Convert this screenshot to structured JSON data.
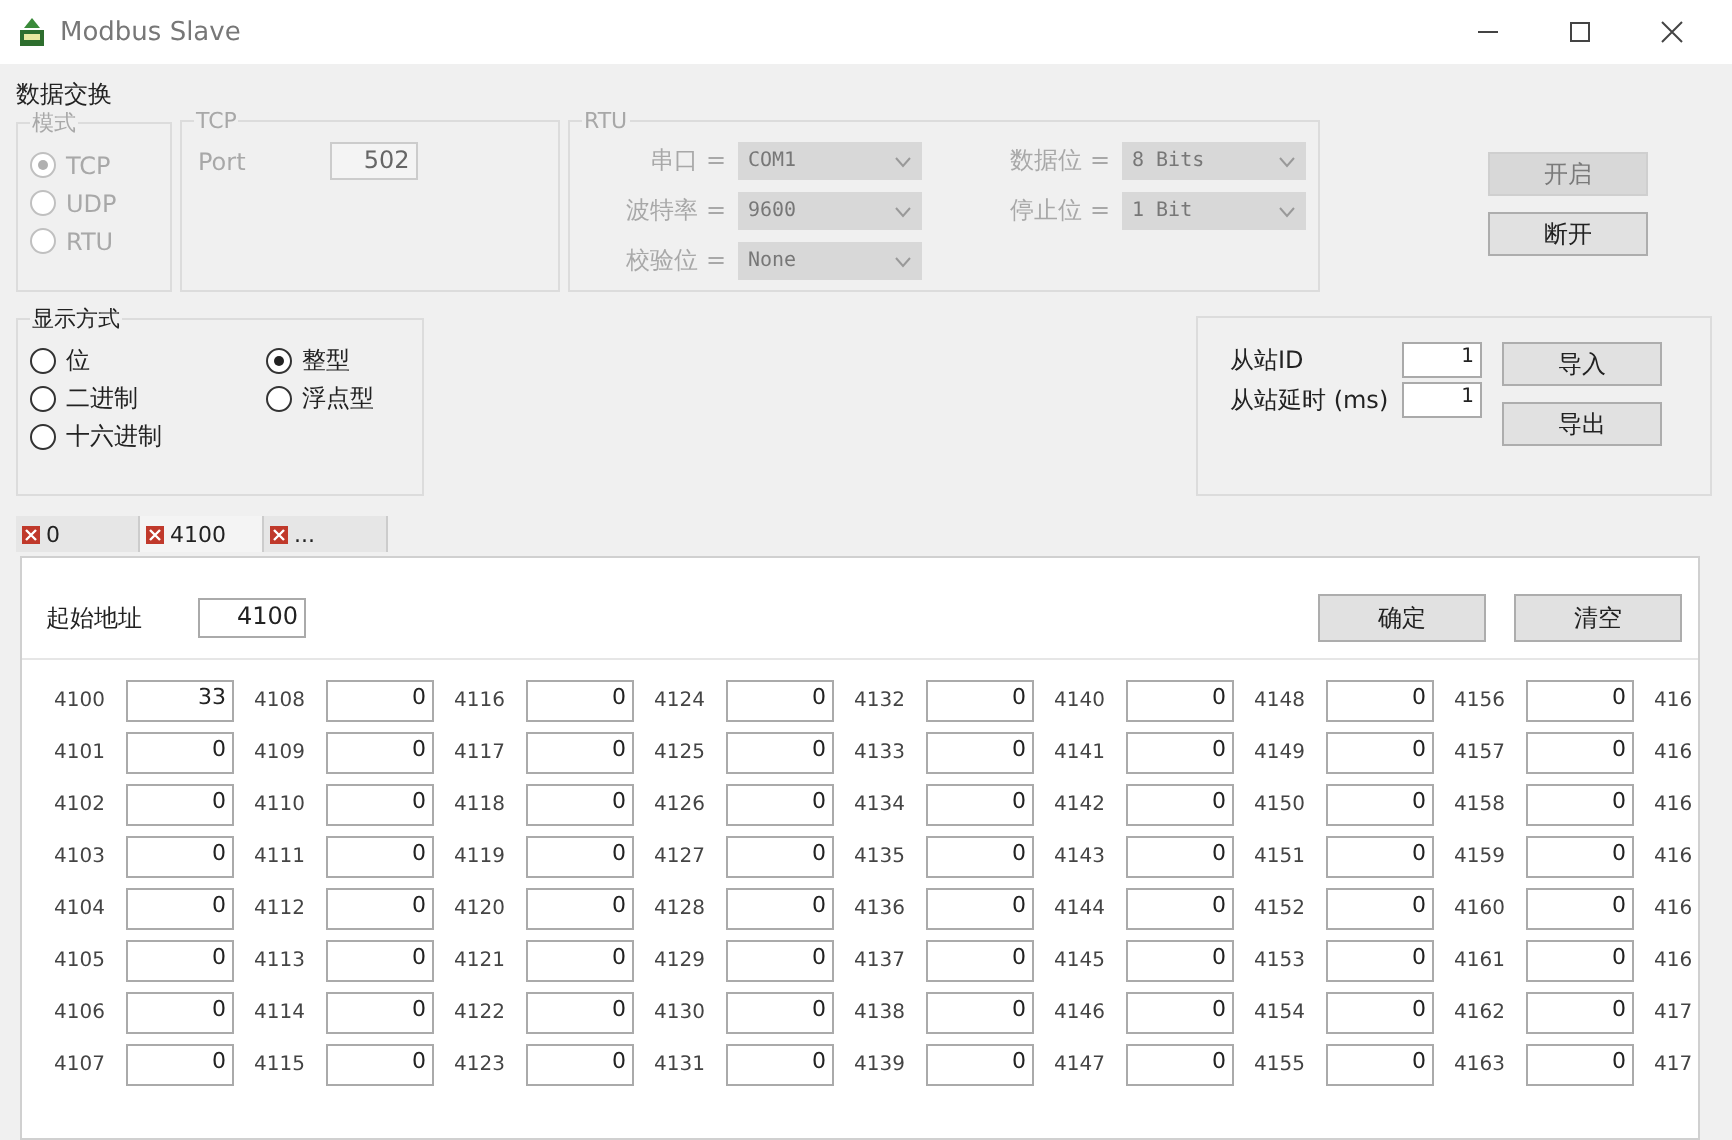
{
  "window": {
    "title": "Modbus Slave"
  },
  "data_exchange": {
    "label": "数据交换",
    "mode": {
      "label": "模式",
      "disabled": true,
      "options": [
        {
          "label": "TCP",
          "selected": true
        },
        {
          "label": "UDP",
          "selected": false
        },
        {
          "label": "RTU",
          "selected": false
        }
      ]
    },
    "tcp": {
      "label": "TCP",
      "port_label": "Port",
      "port": "502",
      "disabled": true
    },
    "rtu": {
      "label": "RTU",
      "disabled": true,
      "fields": [
        {
          "label": "串口 =",
          "value": "COM1"
        },
        {
          "label": "波特率 =",
          "value": "9600"
        },
        {
          "label": "校验位 =",
          "value": "None"
        },
        {
          "label": "数据位 =",
          "value": "8 Bits"
        },
        {
          "label": "停止位 =",
          "value": "1 Bit"
        }
      ]
    },
    "buttons": [
      {
        "label": "开启",
        "disabled": true
      },
      {
        "label": "断开",
        "disabled": false
      }
    ]
  },
  "display": {
    "label": "显示方式",
    "options": [
      {
        "label": "位",
        "selected": false
      },
      {
        "label": "二进制",
        "selected": false
      },
      {
        "label": "十六进制",
        "selected": false
      },
      {
        "label": "整型",
        "selected": true
      },
      {
        "label": "浮点型",
        "selected": false
      }
    ]
  },
  "slave": {
    "id_label": "从站ID",
    "id": "1",
    "delay_label": "从站延时 (ms)",
    "delay": "1",
    "buttons": [
      "导入",
      "导出"
    ]
  },
  "tabs": [
    {
      "label": "0",
      "selected": false
    },
    {
      "label": "4100",
      "selected": true
    },
    {
      "label": "...",
      "selected": false
    }
  ],
  "registers": {
    "start_label": "起始地址",
    "start": "4100",
    "buttons": [
      "确定",
      "清空"
    ],
    "columns": [
      [
        [
          "4100",
          "33"
        ],
        [
          "4101",
          "0"
        ],
        [
          "4102",
          "0"
        ],
        [
          "4103",
          "0"
        ],
        [
          "4104",
          "0"
        ],
        [
          "4105",
          "0"
        ],
        [
          "4106",
          "0"
        ],
        [
          "4107",
          "0"
        ]
      ],
      [
        [
          "4108",
          "0"
        ],
        [
          "4109",
          "0"
        ],
        [
          "4110",
          "0"
        ],
        [
          "4111",
          "0"
        ],
        [
          "4112",
          "0"
        ],
        [
          "4113",
          "0"
        ],
        [
          "4114",
          "0"
        ],
        [
          "4115",
          "0"
        ]
      ],
      [
        [
          "4116",
          "0"
        ],
        [
          "4117",
          "0"
        ],
        [
          "4118",
          "0"
        ],
        [
          "4119",
          "0"
        ],
        [
          "4120",
          "0"
        ],
        [
          "4121",
          "0"
        ],
        [
          "4122",
          "0"
        ],
        [
          "4123",
          "0"
        ]
      ],
      [
        [
          "4124",
          "0"
        ],
        [
          "4125",
          "0"
        ],
        [
          "4126",
          "0"
        ],
        [
          "4127",
          "0"
        ],
        [
          "4128",
          "0"
        ],
        [
          "4129",
          "0"
        ],
        [
          "4130",
          "0"
        ],
        [
          "4131",
          "0"
        ]
      ],
      [
        [
          "4132",
          "0"
        ],
        [
          "4133",
          "0"
        ],
        [
          "4134",
          "0"
        ],
        [
          "4135",
          "0"
        ],
        [
          "4136",
          "0"
        ],
        [
          "4137",
          "0"
        ],
        [
          "4138",
          "0"
        ],
        [
          "4139",
          "0"
        ]
      ],
      [
        [
          "4140",
          "0"
        ],
        [
          "4141",
          "0"
        ],
        [
          "4142",
          "0"
        ],
        [
          "4143",
          "0"
        ],
        [
          "4144",
          "0"
        ],
        [
          "4145",
          "0"
        ],
        [
          "4146",
          "0"
        ],
        [
          "4147",
          "0"
        ]
      ],
      [
        [
          "4148",
          "0"
        ],
        [
          "4149",
          "0"
        ],
        [
          "4150",
          "0"
        ],
        [
          "4151",
          "0"
        ],
        [
          "4152",
          "0"
        ],
        [
          "4153",
          "0"
        ],
        [
          "4154",
          "0"
        ],
        [
          "4155",
          "0"
        ]
      ],
      [
        [
          "4156",
          "0"
        ],
        [
          "4157",
          "0"
        ],
        [
          "4158",
          "0"
        ],
        [
          "4159",
          "0"
        ],
        [
          "4160",
          "0"
        ],
        [
          "4161",
          "0"
        ],
        [
          "4162",
          "0"
        ],
        [
          "4163",
          "0"
        ]
      ]
    ],
    "cut_column": [
      "416",
      "416",
      "416",
      "416",
      "416",
      "416",
      "417",
      "417"
    ]
  }
}
